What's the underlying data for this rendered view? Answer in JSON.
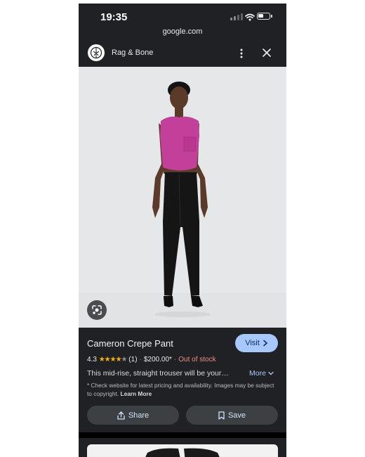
{
  "status_bar": {
    "time": "19:35"
  },
  "browser": {
    "url": "google.com"
  },
  "site": {
    "name": "Rag & Bone"
  },
  "product": {
    "title": "Cameron Crepe Pant",
    "visit_label": "Visit",
    "rating": "4.3",
    "rating_stars": 4.3,
    "stars_text": "★★★★",
    "star_empty_text": "★",
    "review_count": "(1)",
    "separator": "·",
    "price": "$200.00*",
    "availability": "Out of stock",
    "description": "This mid-rise, straight trouser will be your…",
    "more_label": "More",
    "disclaimer": "* Check website for latest pricing and availability. Images may be subject to copyright.",
    "learn_more": "Learn More"
  },
  "actions": {
    "share_label": "Share",
    "save_label": "Save"
  },
  "colors": {
    "background": "#202124",
    "visit_button": "#a8c7fa",
    "out_of_stock": "#f28b82",
    "star": "#f6b400",
    "top": "#c2409a",
    "photo_background": "#e6e7e9"
  },
  "icons": [
    "signal-icon",
    "wifi-icon",
    "battery-icon",
    "site-logo-icon",
    "more-vert-icon",
    "close-icon",
    "lens-icon",
    "chevron-right-icon",
    "chevron-down-icon",
    "share-icon",
    "bookmark-icon"
  ]
}
